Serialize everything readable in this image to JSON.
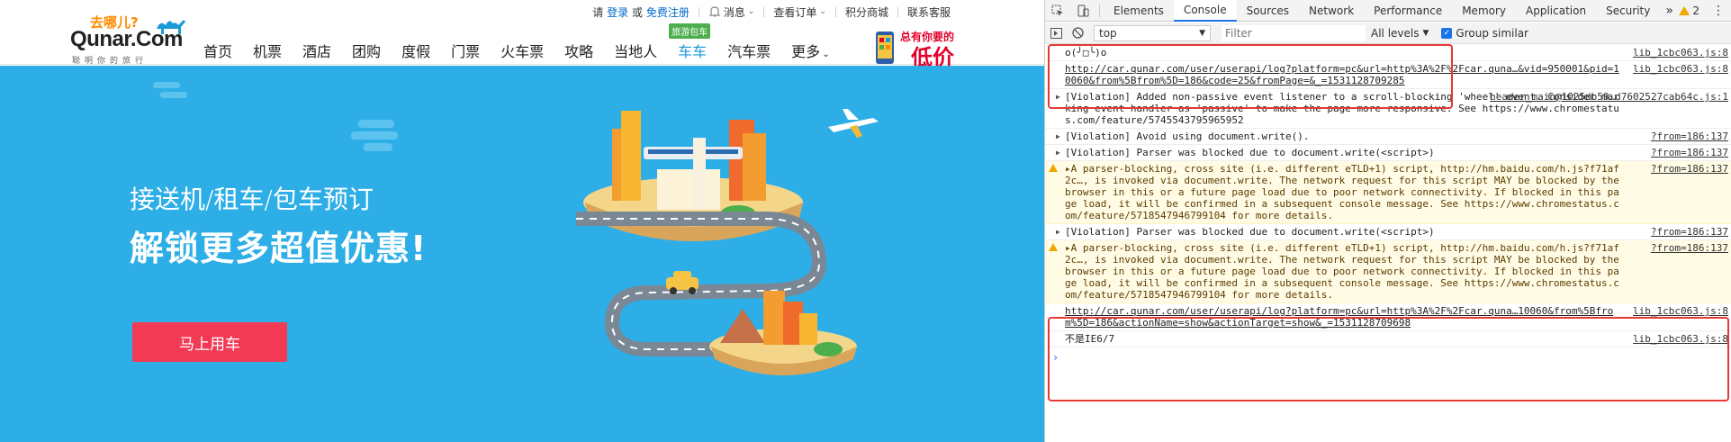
{
  "site": {
    "logo": {
      "slogan": "去哪儿?",
      "brand": "Qunar.Com",
      "sub": "聪明你的旅行"
    },
    "topbar": {
      "greeting": "请",
      "login": "登录",
      "or": "或",
      "register": "免费注册",
      "messages": "消息",
      "orders": "查看订单",
      "points_mall": "积分商城",
      "support": "联系客服"
    },
    "nav": [
      {
        "label": "首页"
      },
      {
        "label": "机票"
      },
      {
        "label": "酒店"
      },
      {
        "label": "团购"
      },
      {
        "label": "度假"
      },
      {
        "label": "门票"
      },
      {
        "label": "火车票"
      },
      {
        "label": "攻略"
      },
      {
        "label": "当地人"
      },
      {
        "label": "车车",
        "badge": "旅游包车",
        "active": true
      },
      {
        "label": "汽车票"
      },
      {
        "label": "更多"
      }
    ],
    "promo": {
      "line1": "总有你要的",
      "line2": "低价"
    },
    "hero": {
      "title": "接送机/租车/包车预订",
      "subtitle": "解锁更多超值优惠!",
      "cta": "马上用车"
    },
    "colors": {
      "hero_bg": "#2eaee6",
      "cta_bg": "#f23a55",
      "nav_active": "#1b9ad8"
    }
  },
  "devtools": {
    "tabs": [
      "Elements",
      "Console",
      "Sources",
      "Network",
      "Performance",
      "Memory",
      "Application",
      "Security"
    ],
    "active_tab": "Console",
    "warning_count": "2",
    "toolbar": {
      "context": "top",
      "filter_placeholder": "Filter",
      "levels": "All levels",
      "group_similar": "Group similar"
    },
    "console_rows": [
      {
        "type": "log",
        "msg": "o(╯□╰)o",
        "src": "lib_1cbc063.js:8"
      },
      {
        "type": "log",
        "link": true,
        "msg": "http://car.qunar.com/user/userapi/log?platform=pc&url=http%3A%2F%2Fcar.quna…&vid=950001&pid=10060&from%5Bfrom%5D=186&code=25&fromPage=&_=1531128709285",
        "src": "lib_1cbc063.js:8"
      },
      {
        "type": "violation",
        "msg": "[Violation] Added non-passive event listener to a scroll-blocking 'wheel' event. Consider marking event handler as 'passive' to make the page more responsive. See https://www.chromestatus.com/feature/5745543795965952",
        "src": "header_main@1025db59…d7602527cab64c.js:1"
      },
      {
        "type": "violation",
        "msg": "[Violation] Avoid using document.write().",
        "src": "?from=186:137"
      },
      {
        "type": "violation",
        "msg": "[Violation] Parser was blocked due to document.write(<script>)",
        "src": "?from=186:137"
      },
      {
        "type": "warning",
        "msg": "▸A parser-blocking, cross site (i.e. different eTLD+1) script, http://hm.baidu.com/h.js?f71af2c…, is invoked via document.write. The network request for this script MAY be blocked by the browser in this or a future page load due to poor network connectivity. If blocked in this page load, it will be confirmed in a subsequent console message. See https://www.chromestatus.com/feature/5718547946799104 for more details.",
        "src": "?from=186:137"
      },
      {
        "type": "violation",
        "msg": "[Violation] Parser was blocked due to document.write(<script>)",
        "src": "?from=186:137"
      },
      {
        "type": "warning",
        "msg": "▸A parser-blocking, cross site (i.e. different eTLD+1) script, http://hm.baidu.com/h.js?f71af2c…, is invoked via document.write. The network request for this script MAY be blocked by the browser in this or a future page load due to poor network connectivity. If blocked in this page load, it will be confirmed in a subsequent console message. See https://www.chromestatus.com/feature/5718547946799104 for more details.",
        "src": "?from=186:137"
      },
      {
        "type": "log",
        "link": true,
        "msg": "http://car.qunar.com/user/userapi/log?platform=pc&url=http%3A%2F%2Fcar.quna…10060&from%5Bfrom%5D=186&actionName=show&actionTarget=show&_=1531128709698",
        "src": "lib_1cbc063.js:8"
      },
      {
        "type": "log",
        "msg": "不是IE6/7",
        "src": "lib_1cbc063.js:8"
      }
    ],
    "prompt": "›"
  }
}
